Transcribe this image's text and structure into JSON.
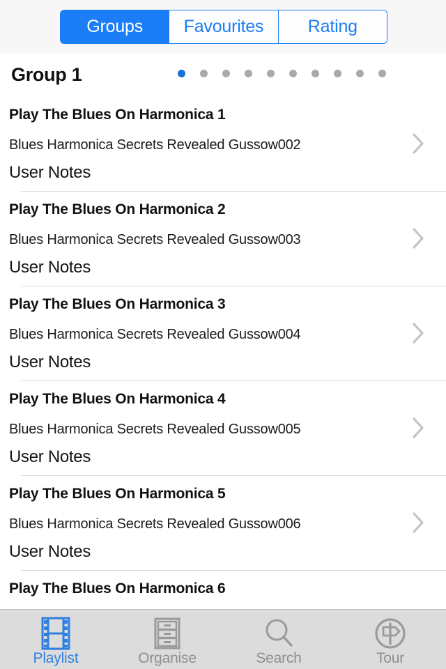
{
  "segmented_control": {
    "selected": "Groups",
    "options": [
      {
        "label": "Groups",
        "active": true
      },
      {
        "label": "Favourites",
        "active": false
      },
      {
        "label": "Rating",
        "active": false
      }
    ],
    "accent_color": "#1b7ef7"
  },
  "group_header": {
    "title": "Group 1",
    "page_dots": {
      "count": 10,
      "active_index": 0,
      "active_color": "#1572d3",
      "inactive_color": "#a9a9a9"
    }
  },
  "list": {
    "notes_label": "User Notes",
    "rows": [
      {
        "title": "Play The Blues On Harmonica 1",
        "subtitle": "Blues Harmonica Secrets Revealed Gussow002",
        "notes": "User Notes"
      },
      {
        "title": "Play The Blues On Harmonica 2",
        "subtitle": "Blues Harmonica Secrets Revealed Gussow003",
        "notes": "User Notes"
      },
      {
        "title": "Play The Blues On Harmonica 3",
        "subtitle": "Blues Harmonica Secrets Revealed Gussow004",
        "notes": "User Notes"
      },
      {
        "title": "Play The Blues On Harmonica 4",
        "subtitle": "Blues Harmonica Secrets Revealed Gussow005",
        "notes": "User Notes"
      },
      {
        "title": "Play The Blues On Harmonica 5",
        "subtitle": "Blues Harmonica Secrets Revealed Gussow006",
        "notes": "User Notes"
      },
      {
        "title": "Play The Blues On Harmonica 6",
        "subtitle": "",
        "notes": ""
      }
    ]
  },
  "tabbar": {
    "active": "Playlist",
    "active_color": "#2f7fe0",
    "inactive_color": "#8e8e8e",
    "tabs": [
      {
        "label": "Playlist",
        "icon": "film-strip-icon",
        "active": true
      },
      {
        "label": "Organise",
        "icon": "filing-cabinet-icon",
        "active": false
      },
      {
        "label": "Search",
        "icon": "magnifier-icon",
        "active": false
      },
      {
        "label": "Tour",
        "icon": "signpost-circle-icon",
        "active": false
      }
    ]
  }
}
